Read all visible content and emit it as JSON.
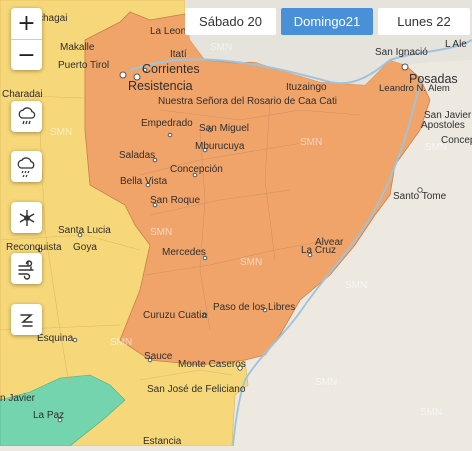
{
  "tabs": [
    {
      "label": "Sábado 20",
      "active": false
    },
    {
      "label": "Domingo21",
      "active": true
    },
    {
      "label": "Lunes 22",
      "active": false
    }
  ],
  "zoom": {
    "in": "+",
    "out": "−"
  },
  "layers": [
    "rain-cloud-icon",
    "storm-cloud-icon",
    "snowflake-icon",
    "wind-icon",
    "dust-icon"
  ],
  "alert_colors": {
    "orange": "#f0a46a",
    "yellow": "#f6d779",
    "green": "#74d4ae",
    "no_alert": "#ede9e1"
  },
  "watermark": "SMN",
  "places": {
    "chagai": "chagai",
    "la_leon": "La Leon",
    "itati": "Itatí",
    "san_ignacio": "San Ignació",
    "l_ale": "L Ale",
    "makalle": "Makalle",
    "puerto_tirol": "Puerto Tirol",
    "corrientes": "Corrientes",
    "resistencia": "Resistencia",
    "ituzaingo": "Ituzaingo",
    "posadas": "Posadas",
    "leandro_alem": "Leandro N. Alem",
    "charadai": "Charadai",
    "nuestra_senora": "Nuestra Señora del Rosario de Caa Cati",
    "san_javier_n": "San Javier",
    "apostoles": "Apostoles",
    "empedrado": "Empedrado",
    "san_miguel": "San Miguel",
    "concep_r": "Concep",
    "mburucuya": "Mburucuya",
    "saladas": "Saladas",
    "concepcion": "Concepción",
    "bella_vista": "Bella Vista",
    "santo_tome": "Santo Tome",
    "san_roque": "San Roque",
    "santa_lucia": "Santa Lucia",
    "reconquista": "Reconquista",
    "goya": "Goya",
    "alvear": "Alvear",
    "mercedes": "Mercedes",
    "la_cruz": "La Cruz",
    "paso_libres": "Paso de los Libres",
    "curuzu_cuatia": "Curuzu Cuatia",
    "esquina": "Esquina",
    "sauce": "Sauce",
    "monte_caseros": "Monte Caseros",
    "san_jose_feliciano": "San José de Feliciano",
    "san_javier_s": "n Javier",
    "la_paz": "La Paz",
    "estancia": "Estancia"
  }
}
